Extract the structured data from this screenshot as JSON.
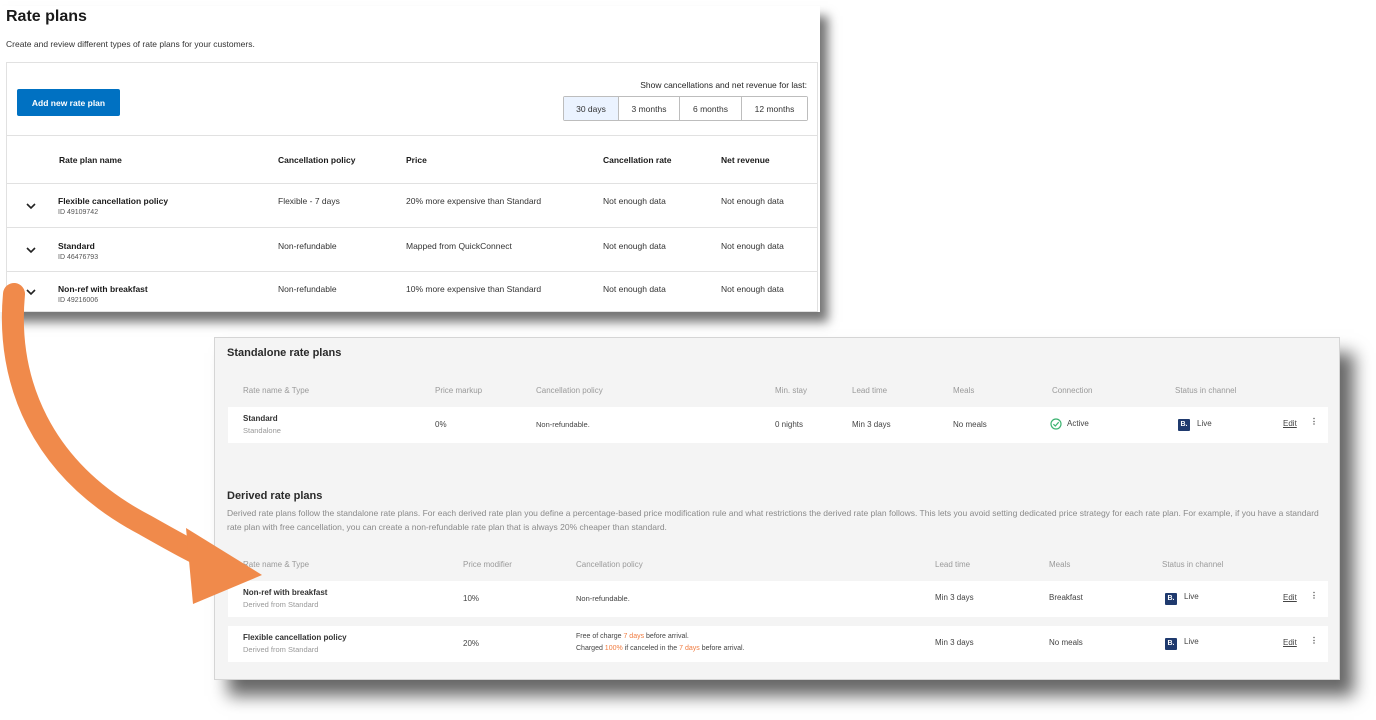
{
  "top": {
    "title": "Rate plans",
    "subtitle": "Create and review different types of rate plans for your customers.",
    "add_button": "Add new rate plan",
    "period_label": "Show cancellations and net revenue for last:",
    "periods": [
      "30 days",
      "3 months",
      "6 months",
      "12 months"
    ],
    "columns": [
      "Rate plan name",
      "Cancellation policy",
      "Price",
      "Cancellation rate",
      "Net revenue"
    ],
    "rows": [
      {
        "name": "Flexible cancellation policy",
        "id": "ID 49109742",
        "policy": "Flexible - 7 days",
        "price": "20% more expensive than Standard",
        "cancel_rate": "Not enough data",
        "revenue": "Not enough data"
      },
      {
        "name": "Standard",
        "id": "ID 46476793",
        "policy": "Non-refundable",
        "price": "Mapped from QuickConnect",
        "cancel_rate": "Not enough data",
        "revenue": "Not enough data"
      },
      {
        "name": "Non-ref with breakfast",
        "id": "ID 49216006",
        "policy": "Non-refundable",
        "price": "10% more expensive than Standard",
        "cancel_rate": "Not enough data",
        "revenue": "Not enough data"
      }
    ]
  },
  "standalone": {
    "title": "Standalone rate plans",
    "columns": [
      "Rate name & Type",
      "Price markup",
      "Cancellation policy",
      "Min. stay",
      "Lead time",
      "Meals",
      "Connection",
      "Status in channel"
    ],
    "row": {
      "name": "Standard",
      "type": "Standalone",
      "markup": "0%",
      "policy": "Non-refundable.",
      "min_stay": "0 nights",
      "lead": "Min 3 days",
      "meals": "No meals",
      "connection": "Active",
      "status": "Live",
      "edit": "Edit"
    }
  },
  "derived": {
    "title": "Derived rate plans",
    "description": "Derived rate plans follow the standalone rate plans. For each derived rate plan you define a percentage-based price modification rule and what restrictions the derived rate plan follows. This lets you avoid setting dedicated price strategy for each rate plan. For example, if you have a standard rate plan with free cancellation, you can create a non-refundable rate plan that is always 20% cheaper than standard.",
    "columns": [
      "Rate name & Type",
      "Price modifier",
      "Cancellation policy",
      "Lead time",
      "Meals",
      "Status in channel"
    ],
    "rows": [
      {
        "name": "Non-ref with breakfast",
        "type": "Derived from Standard",
        "modifier": "10%",
        "policy": "Non-refundable.",
        "lead": "Min 3 days",
        "meals": "Breakfast",
        "status": "Live",
        "edit": "Edit"
      },
      {
        "name": "Flexible cancellation policy",
        "type": "Derived from Standard",
        "modifier": "20%",
        "policy_l1_a": "Free of charge ",
        "policy_l1_b": "7 days",
        "policy_l1_c": " before arrival.",
        "policy_l2_a": "Charged ",
        "policy_l2_b": "100%",
        "policy_l2_c": " if canceled in the ",
        "policy_l2_d": "7 days",
        "policy_l2_e": " before arrival.",
        "lead": "Min 3 days",
        "meals": "No meals",
        "status": "Live",
        "edit": "Edit"
      }
    ]
  },
  "badge_letter": "B.",
  "kebab_glyph": "⋮",
  "colors": {
    "primary": "#0071c2",
    "live": "#3cb371",
    "badge": "#1f3a6e",
    "arrow": "#f08a4b",
    "highlight": "#f07b3f"
  }
}
